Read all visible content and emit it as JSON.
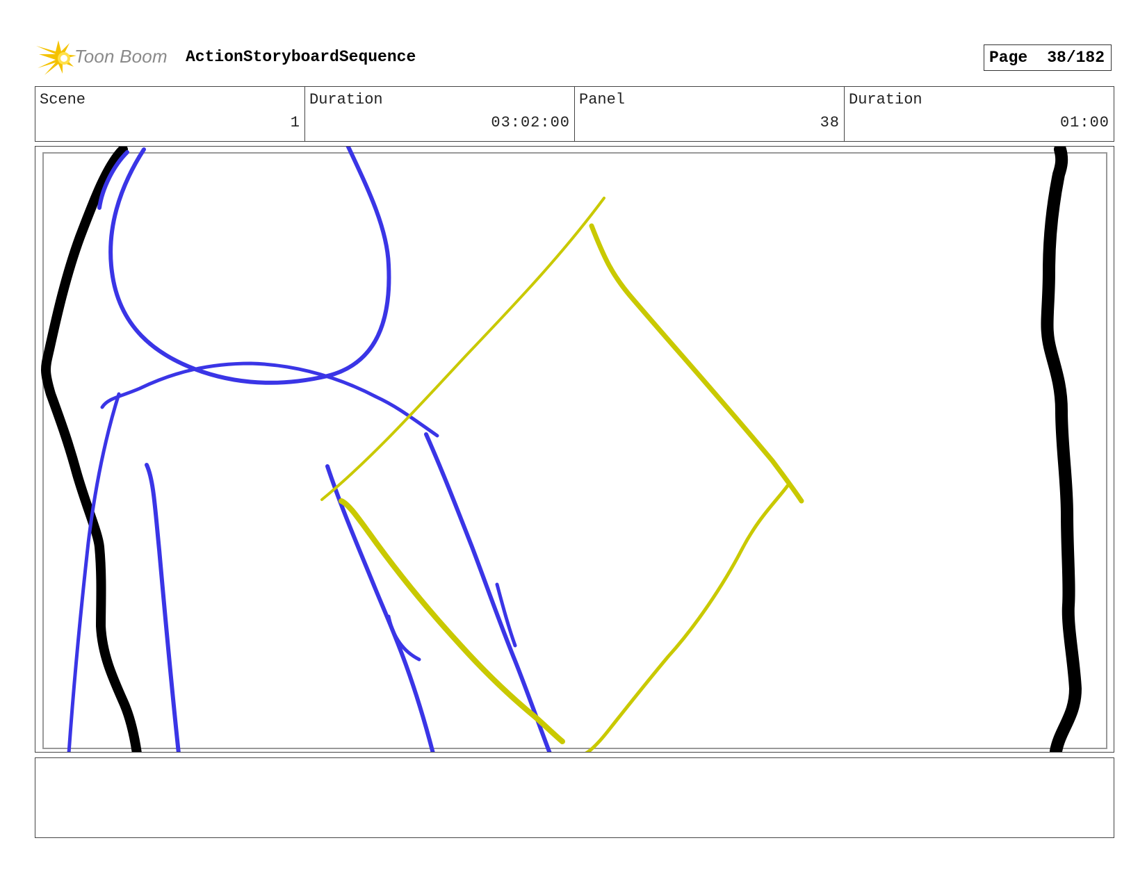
{
  "header": {
    "brand": "Toon Boom",
    "title": "ActionStoryboardSequence",
    "page_label": "Page",
    "page_value": "38/182"
  },
  "info": [
    {
      "label": "Scene",
      "value": "1"
    },
    {
      "label": "Duration",
      "value": "03:02:00"
    },
    {
      "label": "Panel",
      "value": "38"
    },
    {
      "label": "Duration",
      "value": "01:00"
    }
  ],
  "notes": {
    "text": ""
  },
  "colors": {
    "sketch_black": "#000000",
    "sketch_blue": "#3a35e6",
    "sketch_yellow": "#c9c900",
    "logo_yellow": "#f4c200"
  }
}
